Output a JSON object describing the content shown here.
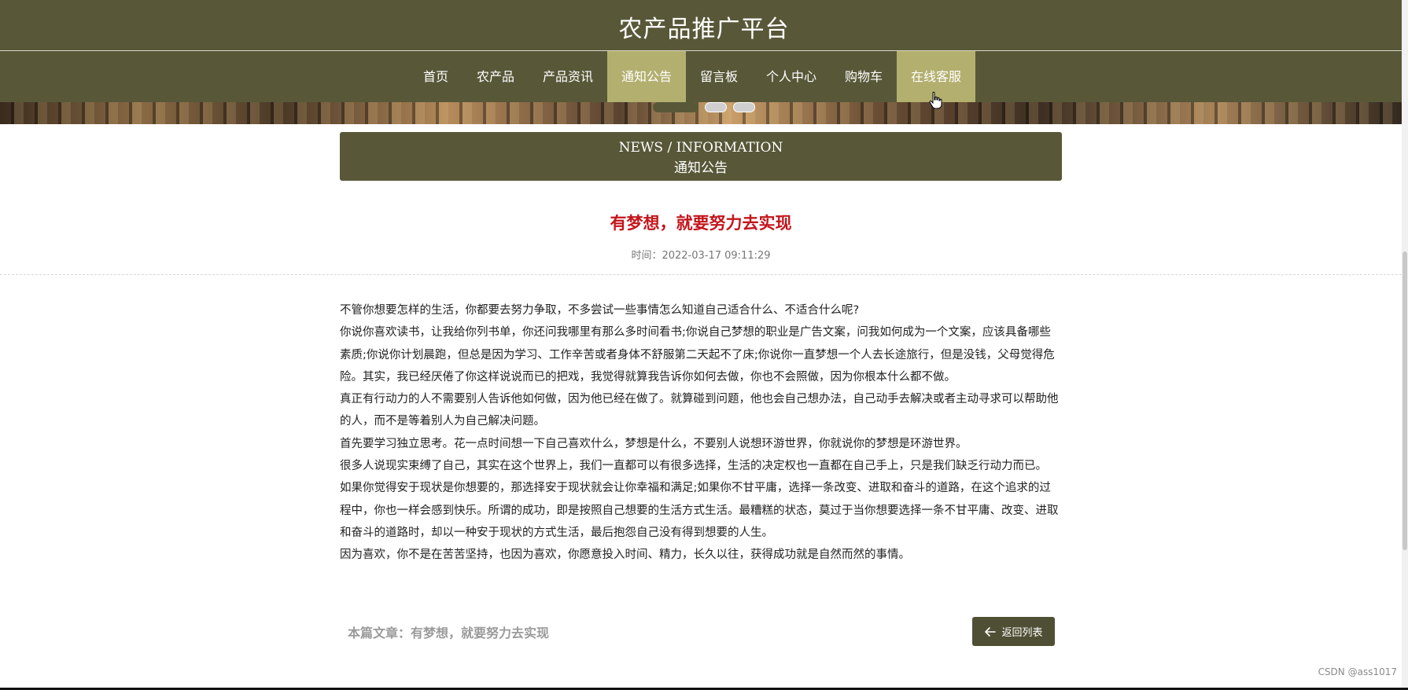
{
  "header": {
    "site_title": "农产品推广平台"
  },
  "nav": {
    "items": [
      {
        "label": "首页"
      },
      {
        "label": "农产品"
      },
      {
        "label": "产品资讯"
      },
      {
        "label": "通知公告",
        "active": true
      },
      {
        "label": "留言板"
      },
      {
        "label": "个人中心"
      },
      {
        "label": "购物车"
      },
      {
        "label": "在线客服",
        "hover": true
      }
    ]
  },
  "section": {
    "en": "NEWS / INFORMATION",
    "cn": "通知公告"
  },
  "article": {
    "title": "有梦想，就要努力去实现",
    "time": "时间：2022-03-17 09:11:29",
    "paragraphs": [
      "不管你想要怎样的生活，你都要去努力争取，不多尝试一些事情怎么知道自己适合什么、不适合什么呢?",
      "你说你喜欢读书，让我给你列书单，你还问我哪里有那么多时间看书;你说自己梦想的职业是广告文案，问我如何成为一个文案，应该具备哪些素质;你说你计划晨跑，但总是因为学习、工作辛苦或者身体不舒服第二天起不了床;你说你一直梦想一个人去长途旅行，但是没钱，父母觉得危险。其实，我已经厌倦了你这样说说而已的把戏，我觉得就算我告诉你如何去做，你也不会照做，因为你根本什么都不做。",
      "真正有行动力的人不需要别人告诉他如何做，因为他已经在做了。就算碰到问题，他也会自己想办法，自己动手去解决或者主动寻求可以帮助他的人，而不是等着别人为自己解决问题。",
      "首先要学习独立思考。花一点时间想一下自己喜欢什么，梦想是什么，不要别人说想环游世界，你就说你的梦想是环游世界。",
      "很多人说现实束缚了自己，其实在这个世界上，我们一直都可以有很多选择，生活的决定权也一直都在自己手上，只是我们缺乏行动力而已。",
      "如果你觉得安于现状是你想要的，那选择安于现状就会让你幸福和满足;如果你不甘平庸，选择一条改变、进取和奋斗的道路，在这个追求的过程中，你也一样会感到快乐。所谓的成功，即是按照自己想要的生活方式生活。最糟糕的状态，莫过于当你想要选择一条不甘平庸、改变、进取和奋斗的道路时，却以一种安于现状的方式生活，最后抱怨自己没有得到想要的人生。",
      "因为喜欢，你不是在苦苦坚持，也因为喜欢，你愿意投入时间、精力，长久以往，获得成功就是自然而然的事情。"
    ]
  },
  "footer": {
    "current_label": "本篇文章：",
    "current_title": "有梦想，就要努力去实现",
    "back_label": "返回列表"
  },
  "watermark": "CSDN @ass1017",
  "icons": {
    "back": "arrow-left-icon",
    "cursor": "pointer-hand-icon"
  },
  "colors": {
    "primary": "#585839",
    "active_nav": "#b3af6f",
    "title_red": "#c4151c"
  }
}
